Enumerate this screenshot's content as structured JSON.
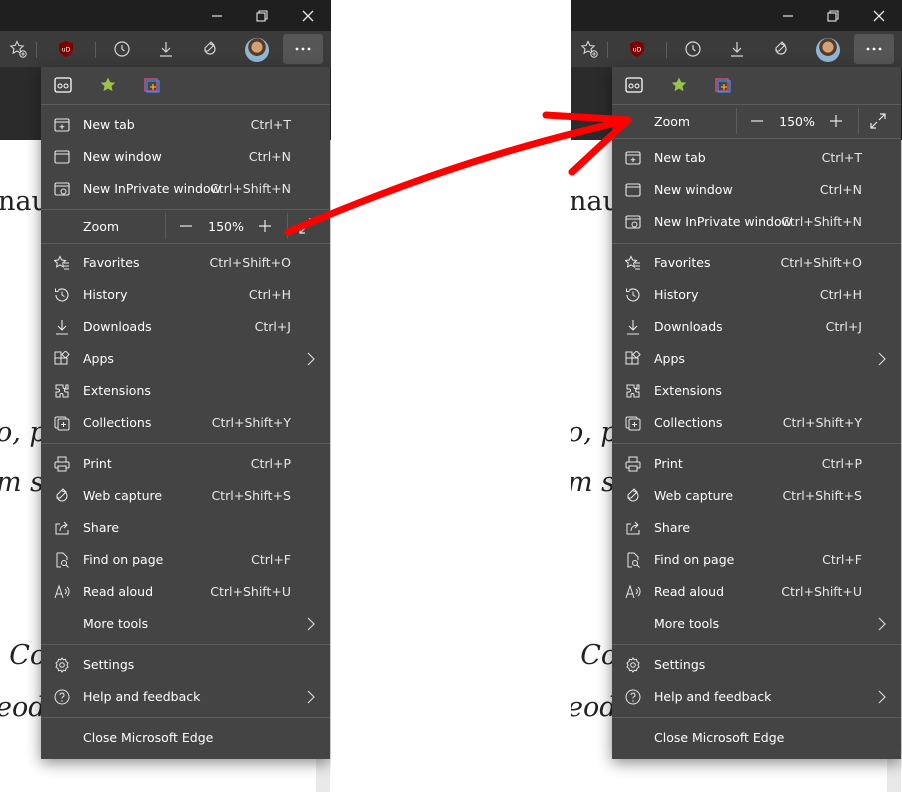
{
  "window_controls": {
    "minimize": "minimize",
    "restore": "restore",
    "close": "close"
  },
  "page_text": [
    {
      "text": "nau",
      "style": "normal"
    },
    {
      "text": "o, p",
      "style": "italic"
    },
    {
      "text": "m si",
      "style": "italic"
    },
    {
      "text": "l Co",
      "style": "italic"
    },
    {
      "text": "eod",
      "style": "italic"
    }
  ],
  "menu": {
    "pinned_icons": [
      "immersive-reader-icon",
      "favorites-star-icon",
      "collections-color-icon"
    ],
    "zoom": {
      "label": "Zoom",
      "value": "150%",
      "minus": "—",
      "plus": "+"
    },
    "items": {
      "new_tab": {
        "label": "New tab",
        "shortcut": "Ctrl+T",
        "icon": "new-tab-icon"
      },
      "new_window": {
        "label": "New window",
        "shortcut": "Ctrl+N",
        "icon": "new-window-icon"
      },
      "new_inprivate": {
        "label": "New InPrivate window",
        "shortcut": "Ctrl+Shift+N",
        "icon": "inprivate-icon"
      },
      "favorites": {
        "label": "Favorites",
        "shortcut": "Ctrl+Shift+O",
        "icon": "favorites-icon"
      },
      "history": {
        "label": "History",
        "shortcut": "Ctrl+H",
        "icon": "history-icon"
      },
      "downloads": {
        "label": "Downloads",
        "shortcut": "Ctrl+J",
        "icon": "downloads-icon"
      },
      "apps": {
        "label": "Apps",
        "shortcut": "",
        "icon": "apps-icon"
      },
      "extensions": {
        "label": "Extensions",
        "shortcut": "",
        "icon": "extensions-icon"
      },
      "collections": {
        "label": "Collections",
        "shortcut": "Ctrl+Shift+Y",
        "icon": "collections-icon"
      },
      "print": {
        "label": "Print",
        "shortcut": "Ctrl+P",
        "icon": "print-icon"
      },
      "web_capture": {
        "label": "Web capture",
        "shortcut": "Ctrl+Shift+S",
        "icon": "web-capture-icon"
      },
      "share": {
        "label": "Share",
        "shortcut": "",
        "icon": "share-icon"
      },
      "find_on_page": {
        "label": "Find on page",
        "shortcut": "Ctrl+F",
        "icon": "find-icon"
      },
      "read_aloud": {
        "label": "Read aloud",
        "shortcut": "Ctrl+Shift+U",
        "icon": "read-aloud-icon"
      },
      "more_tools": {
        "label": "More tools",
        "shortcut": ""
      },
      "settings": {
        "label": "Settings",
        "shortcut": "",
        "icon": "settings-icon"
      },
      "help": {
        "label": "Help and feedback",
        "shortcut": "",
        "icon": "help-icon"
      },
      "close_edge": {
        "label": "Close Microsoft Edge",
        "shortcut": ""
      }
    }
  },
  "colors": {
    "menu_bg": "#444444",
    "titlebar_bg": "#1f1f1f",
    "toolbar_bg": "#3b3b3b",
    "annotation_arrow": "#ff0000"
  }
}
